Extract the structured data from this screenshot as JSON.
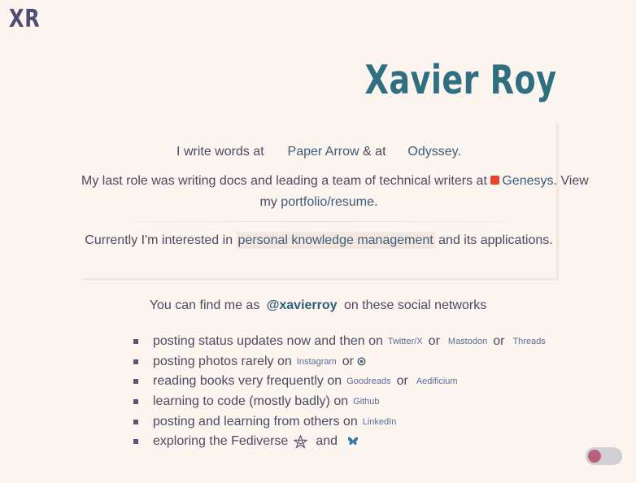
{
  "header": {
    "logo": "XR",
    "name": "Xavier Roy"
  },
  "intro": {
    "write_prefix": "I write words at",
    "paper_arrow": "Paper Arrow",
    "amp_at": "& at",
    "odyssey": "Odyssey",
    "period": ".",
    "role_text": "My last role was writing docs and leading a team of technical writers at",
    "genesys": "Genesys",
    "view": ". View",
    "my": "my",
    "portfolio": "portfolio/resume",
    "interest_prefix": "Currently I'm interested in",
    "pkm": "personal knowledge management",
    "interest_suffix": "and its applications."
  },
  "social": {
    "intro_prefix": "You can find me as",
    "handle": "@xavierroy",
    "intro_suffix": "on these social networks",
    "or": "or",
    "and": "and",
    "items": [
      {
        "text": "posting status updates now and then on",
        "links": [
          "Twitter/X",
          "Mastodon",
          "Threads"
        ]
      },
      {
        "text": "posting photos rarely on",
        "links": [
          "Instagram"
        ]
      },
      {
        "text": "reading books very frequently on",
        "links": [
          "Goodreads",
          "Aedificium"
        ]
      },
      {
        "text": "learning to code (mostly badly) on",
        "links": [
          "Github"
        ]
      },
      {
        "text": "posting and learning from others on",
        "links": [
          "LinkedIn"
        ]
      },
      {
        "text": "exploring the Fediverse",
        "links": []
      }
    ]
  },
  "icons": {
    "pixelfed": "circle-dot-icon",
    "fediverse": "fediverse-star-icon",
    "bluesky": "butterfly-icon"
  },
  "theme": {
    "background": "#fbf4ef",
    "accent": "#2f6f80",
    "toggle_knob": "#b9617b"
  }
}
